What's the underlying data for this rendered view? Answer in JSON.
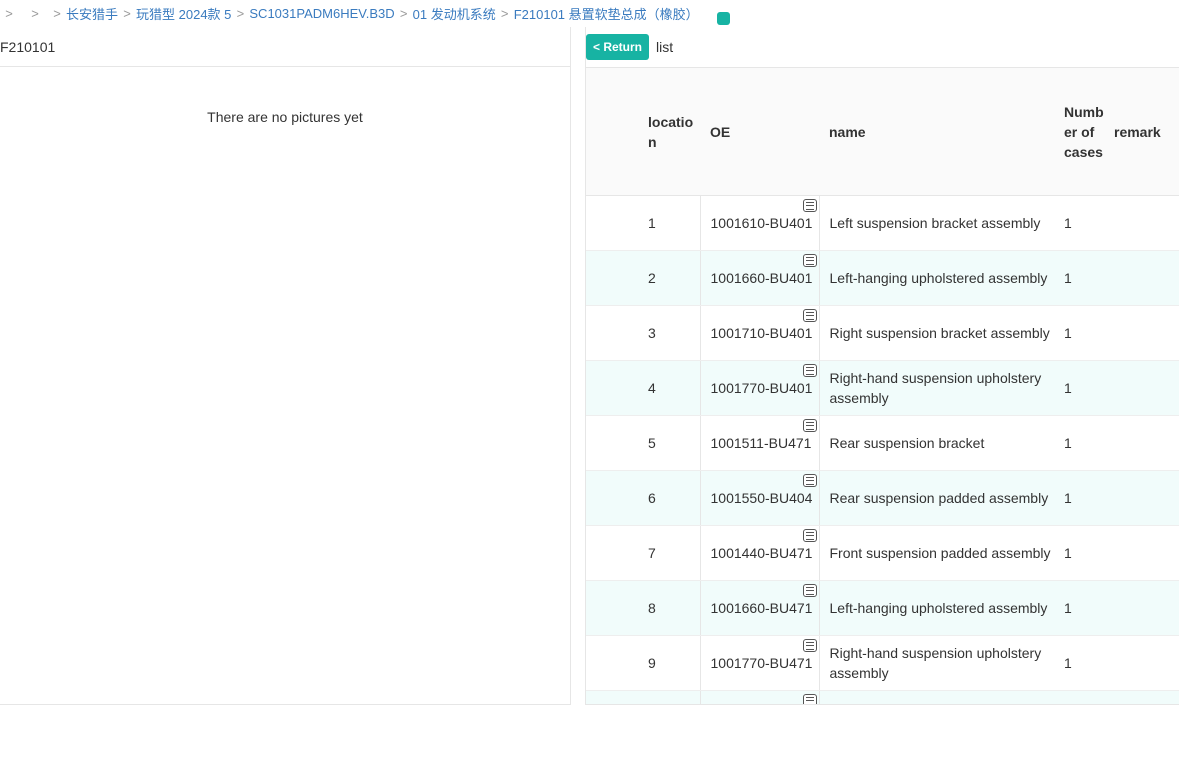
{
  "breadcrumb": {
    "items": [
      "长安猎手",
      "玩猎型 2024款 5",
      "SC1031PADM6HEV.B3D",
      "01 发动机系统",
      "F210101 悬置软垫总成（橡胶）"
    ]
  },
  "left": {
    "title": "F210101",
    "empty_text": "There are no pictures yet"
  },
  "right": {
    "return_label": "< Return",
    "list_label": "list"
  },
  "table": {
    "headers": {
      "location": "location",
      "oe": "OE",
      "name": "name",
      "number_of_cases": "Number of cases",
      "remark": "remark"
    },
    "rows": [
      {
        "location": "1",
        "oe": "1001610-BU401",
        "name": "Left suspension bracket assembly",
        "qty": "1",
        "remark": ""
      },
      {
        "location": "2",
        "oe": "1001660-BU401",
        "name": "Left-hanging upholstered assembly",
        "qty": "1",
        "remark": ""
      },
      {
        "location": "3",
        "oe": "1001710-BU401",
        "name": "Right suspension bracket assembly",
        "qty": "1",
        "remark": ""
      },
      {
        "location": "4",
        "oe": "1001770-BU401",
        "name": "Right-hand suspension upholstery assembly",
        "qty": "1",
        "remark": ""
      },
      {
        "location": "5",
        "oe": "1001511-BU471",
        "name": "Rear suspension bracket",
        "qty": "1",
        "remark": ""
      },
      {
        "location": "6",
        "oe": "1001550-BU404",
        "name": "Rear suspension padded assembly",
        "qty": "1",
        "remark": ""
      },
      {
        "location": "7",
        "oe": "1001440-BU471",
        "name": "Front suspension padded assembly",
        "qty": "1",
        "remark": ""
      },
      {
        "location": "8",
        "oe": "1001660-BU471",
        "name": "Left-hanging upholstered assembly",
        "qty": "1",
        "remark": ""
      },
      {
        "location": "9",
        "oe": "1001770-BU471",
        "name": "Right-hand suspension upholstery assembly",
        "qty": "1",
        "remark": ""
      },
      {
        "location": "",
        "oe": "",
        "name": "",
        "qty": "",
        "remark": ""
      }
    ]
  },
  "colors": {
    "accent": "#17b3a3",
    "link": "#3a7bbf",
    "row_stripe": "#f1fcfb"
  }
}
